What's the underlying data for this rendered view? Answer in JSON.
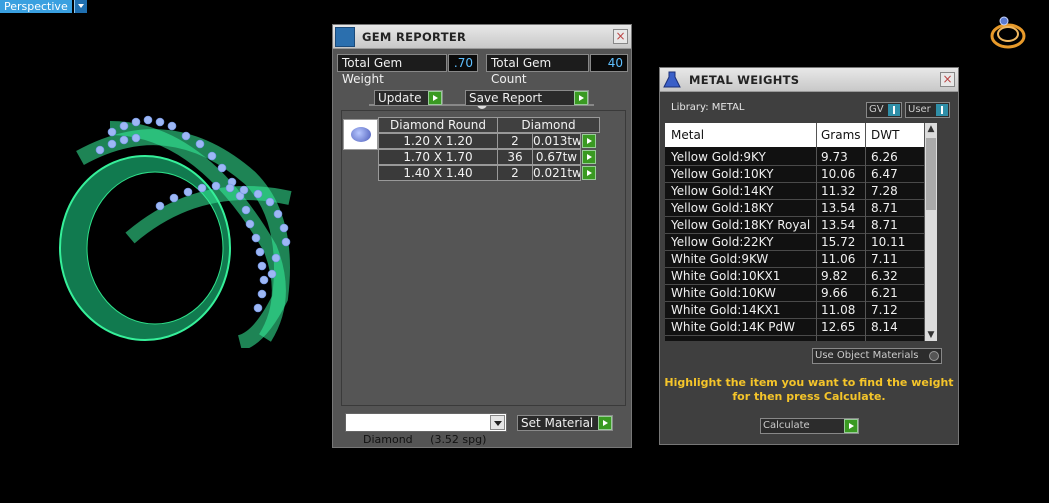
{
  "viewport": {
    "label": "Perspective"
  },
  "gem_reporter": {
    "title": "GEM REPORTER",
    "close": "×",
    "total_weight_label": "Total Gem Weight",
    "total_weight_value": ".70",
    "total_count_label": "Total Gem Count",
    "total_count_value": "40",
    "update_label": "Update",
    "save_report_label": "Save Report",
    "table_headers": [
      "Diamond Round",
      "Diamond"
    ],
    "rows": [
      {
        "size": "1.20 X 1.20",
        "count": "2",
        "weight": "0.013tw"
      },
      {
        "size": "1.70 X 1.70",
        "count": "36",
        "weight": "0.67tw"
      },
      {
        "size": "1.40 X 1.40",
        "count": "2",
        "weight": "0.021tw"
      }
    ],
    "material_select": "Diamond     (3.52 spg)",
    "set_material_label": "Set Material"
  },
  "metal_weights": {
    "title": "METAL WEIGHTS",
    "close": "×",
    "library_label": "Library: METAL",
    "gv_label": "GV",
    "user_label": "User",
    "columns": [
      "Metal",
      "Grams",
      "DWT"
    ],
    "rows": [
      {
        "metal": "Yellow Gold:9KY",
        "grams": "9.73",
        "dwt": "6.26"
      },
      {
        "metal": "Yellow Gold:10KY",
        "grams": "10.06",
        "dwt": "6.47"
      },
      {
        "metal": "Yellow Gold:14KY",
        "grams": "11.32",
        "dwt": "7.28"
      },
      {
        "metal": "Yellow Gold:18KY",
        "grams": "13.54",
        "dwt": "8.71"
      },
      {
        "metal": "Yellow Gold:18KY Royal",
        "grams": "13.54",
        "dwt": "8.71"
      },
      {
        "metal": "Yellow Gold:22KY",
        "grams": "15.72",
        "dwt": "10.11"
      },
      {
        "metal": "White Gold:9KW",
        "grams": "11.06",
        "dwt": "7.11"
      },
      {
        "metal": "White Gold:10KX1",
        "grams": "9.82",
        "dwt": "6.32"
      },
      {
        "metal": "White Gold:10KW",
        "grams": "9.66",
        "dwt": "6.21"
      },
      {
        "metal": "White Gold:14KX1",
        "grams": "11.08",
        "dwt": "7.12"
      },
      {
        "metal": "White Gold:14K PdW",
        "grams": "12.65",
        "dwt": "8.14"
      }
    ],
    "use_object_materials_label": "Use Object Materials",
    "hint_line1": "Highlight the item you want to find the weight",
    "hint_line2": "for then press Calculate.",
    "calculate_label": "Calculate"
  }
}
